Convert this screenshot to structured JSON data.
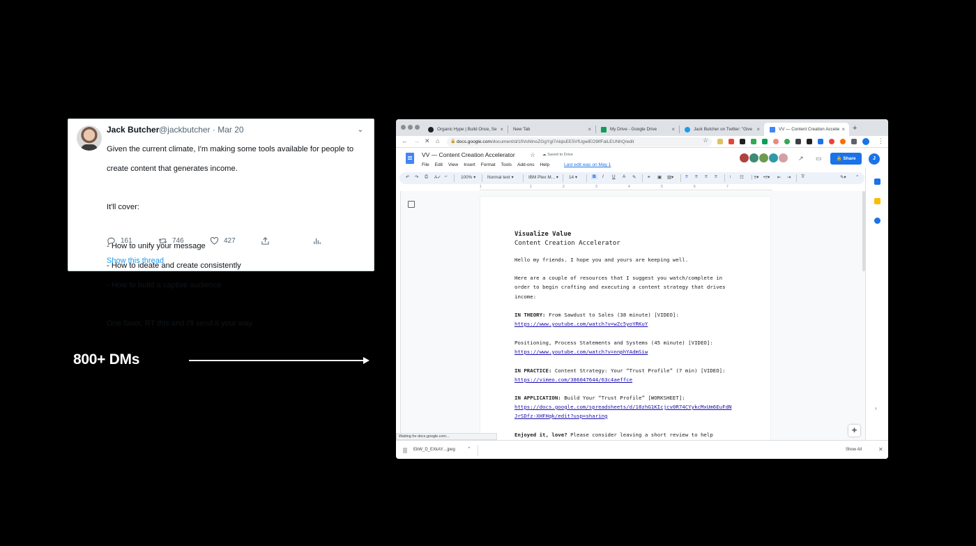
{
  "tweet": {
    "name": "Jack Butcher",
    "handle_date": "@jackbutcher · Mar 20",
    "lines": [
      "Given the current climate, I'm making some tools available for people to",
      "create content that generates income.",
      "",
      "It'll cover:",
      "",
      "- How to unify your message",
      "- How to ideate and create consistently",
      "- How to build a captive audience",
      "",
      "One favor, RT this and I'll send it your way."
    ],
    "replies": "161",
    "retweets": "746",
    "likes": "427",
    "show_thread": "Show this thread"
  },
  "label": "800+ DMs",
  "browser": {
    "tabs": [
      {
        "title": "Organic Hype | Build Once, Se",
        "fav_color": "#202124"
      },
      {
        "title": "New Tab",
        "fav_color": ""
      },
      {
        "title": "My Drive - Google Drive",
        "fav_color": "#0f9d58"
      },
      {
        "title": "Jack Butcher on Twitter: \"Give",
        "fav_color": "#1d9bf0"
      },
      {
        "title": "VV — Content Creation Acceler",
        "fav_color": "#4285f4"
      }
    ],
    "url_host": "docs.google.com",
    "url_path": "/document/d/1fiVoNlnoZGgYgl7AlqisEE5VfUgwlEO9lfFalLEUNhQ/edit",
    "status": "Waiting for docs.google.com...",
    "download_name": "EbW_D_EXkAY....jpeg",
    "show_all": "Show All"
  },
  "docs": {
    "title": "VV — Content Creation Accelerator",
    "saved": "Saved to Drive",
    "menu": [
      "File",
      "Edit",
      "View",
      "Insert",
      "Format",
      "Tools",
      "Add-ons",
      "Help"
    ],
    "last_edit": "Last edit was on May 1",
    "share": "Share",
    "account_initial": "J",
    "zoom": "100%",
    "style": "Normal text",
    "font": "IBM Plex M...",
    "size": "14",
    "ruler_numbers": [
      "1",
      "1",
      "2",
      "3",
      "4",
      "5",
      "6",
      "7"
    ],
    "collab_colors": [
      "#b0413e",
      "#3d8b74",
      "#6f9a4e",
      "#2e9aa8",
      "#d3a0a6"
    ]
  },
  "doc_lines": [
    {
      "text": "Visualize Value",
      "kind": "h1"
    },
    {
      "text": "Content Creation Accelerator",
      "kind": "h2"
    },
    {
      "text": "Hello my friends. I hope you and yours are keeping well.",
      "kind": "p"
    },
    {
      "text": "Here are a couple of resources that I suggest you watch/complete in",
      "kind": "p"
    },
    {
      "text": "order to begin crafting and executing a content strategy that drives",
      "kind": "p"
    },
    {
      "text": "income:",
      "kind": "p"
    },
    {
      "bold": "IN THEORY:",
      "text": " From Sawdust to Sales (38 minute) [VIDEO]:",
      "kind": "mixed"
    },
    {
      "text": "https://www.youtube.com/watch?v=wZc5yoYRKuY",
      "kind": "link"
    },
    {
      "text": "Positioning, Process Statements and Systems (45 minute) [VIDEO]:",
      "kind": "p"
    },
    {
      "text": "https://www.youtube.com/watch?v=nnphYAdmSiw",
      "kind": "link"
    },
    {
      "bold": "IN PRACTICE:",
      "text": " Content Strategy: Your “Trust Profile” (7 min) [VIDEO]:",
      "kind": "mixed"
    },
    {
      "text": "https://vimeo.com/386047644/63c4aeffce",
      "kind": "link"
    },
    {
      "bold": "IN APPLICATION:",
      "text": " Build Your “Trust Profile” [WORKSHEET]:",
      "kind": "mixed"
    },
    {
      "text": "https://docs.google.com/spreadsheets/d/18zhG1KIcjcv0R74CYykcMxUm6EuFdN",
      "kind": "link"
    },
    {
      "text": "JrSDfz-XHFHqk/edit?usp=sharing",
      "kind": "link"
    },
    {
      "bold": "Enjoyed it, love?",
      "text": " Please consider leaving a short review to help",
      "kind": "mixed"
    }
  ]
}
